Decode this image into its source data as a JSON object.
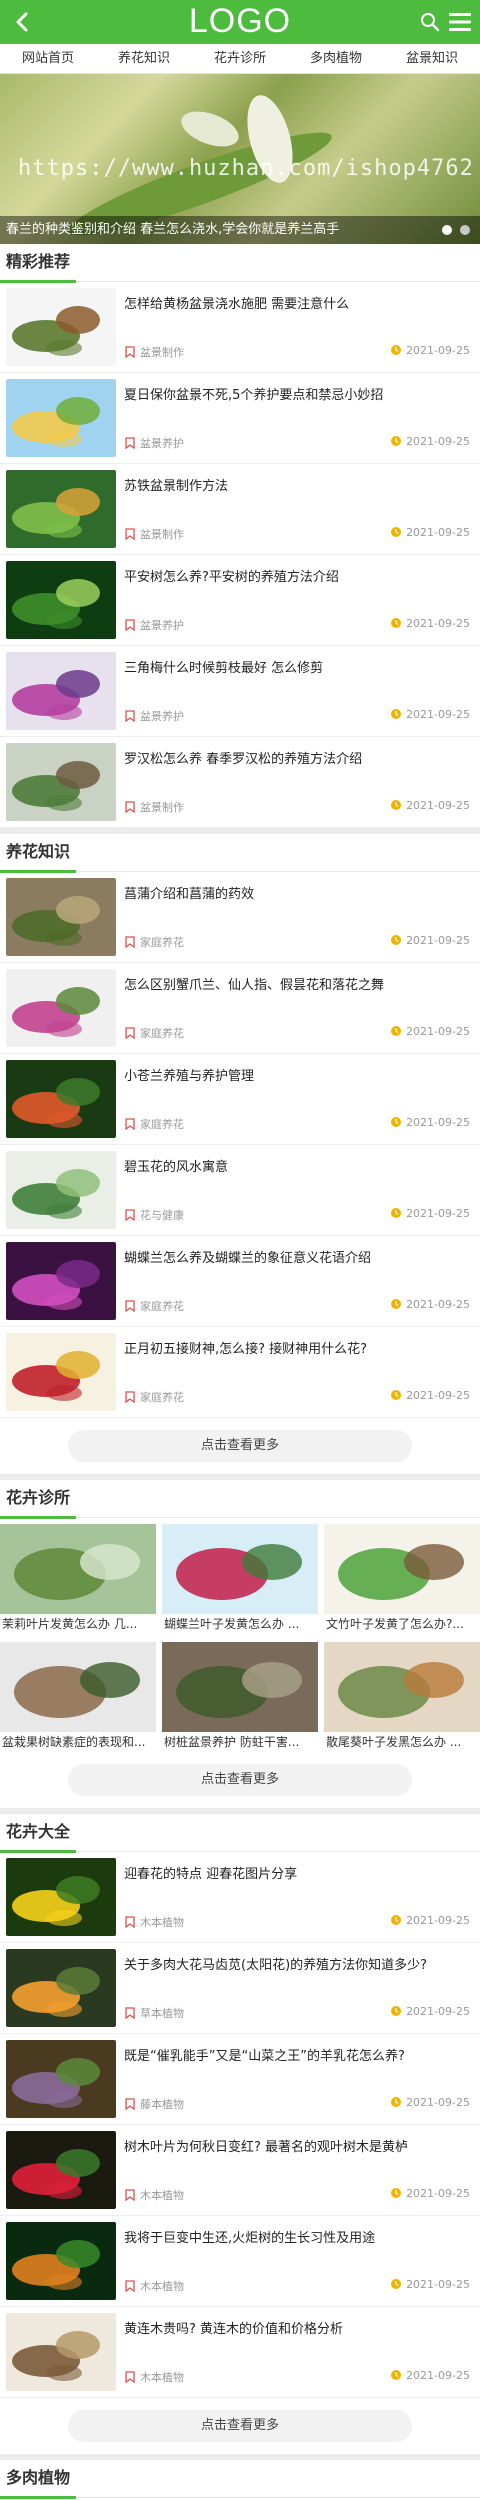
{
  "header": {
    "logo": "LOGO"
  },
  "nav": [
    "网站首页",
    "养花知识",
    "花卉诊所",
    "多肉植物",
    "盆景知识"
  ],
  "banner": {
    "watermark": "https://www.huzhan.com/ishop4762",
    "caption": "春兰的种类鉴别和介绍 春兰怎么浇水,学会你就是养兰高手"
  },
  "featured": {
    "title": "精彩推荐",
    "items": [
      {
        "title": "怎样给黄杨盆景浇水施肥 需要注意什么",
        "cat": "盆景制作",
        "date": "2021-09-25"
      },
      {
        "title": "夏日保你盆景不死,5个养护要点和禁忌小妙招",
        "cat": "盆景养护",
        "date": "2021-09-25"
      },
      {
        "title": "苏铁盆景制作方法",
        "cat": "盆景制作",
        "date": "2021-09-25"
      },
      {
        "title": "平安树怎么养?平安树的养殖方法介绍",
        "cat": "盆景养护",
        "date": "2021-09-25"
      },
      {
        "title": "三角梅什么时候剪枝最好 怎么修剪",
        "cat": "盆景养护",
        "date": "2021-09-25"
      },
      {
        "title": "罗汉松怎么养 春季罗汉松的养殖方法介绍",
        "cat": "盆景制作",
        "date": "2021-09-25"
      }
    ]
  },
  "knowledge": {
    "title": "养花知识",
    "more": "点击查看更多",
    "items": [
      {
        "title": "菖蒲介绍和菖蒲的药效",
        "cat": "家庭养花",
        "date": "2021-09-25"
      },
      {
        "title": "怎么区别蟹爪兰、仙人指、假昙花和落花之舞",
        "cat": "家庭养花",
        "date": "2021-09-25"
      },
      {
        "title": "小苍兰养殖与养护管理",
        "cat": "家庭养花",
        "date": "2021-09-25"
      },
      {
        "title": "碧玉花的风水寓意",
        "cat": "花与健康",
        "date": "2021-09-25"
      },
      {
        "title": "蝴蝶兰怎么养及蝴蝶兰的象征意义花语介绍",
        "cat": "家庭养花",
        "date": "2021-09-25"
      },
      {
        "title": "正月初五接财神,怎么接? 接财神用什么花?",
        "cat": "家庭养花",
        "date": "2021-09-25"
      }
    ]
  },
  "clinic": {
    "title": "花卉诊所",
    "more": "点击查看更多",
    "items": [
      {
        "label": "茉莉叶片发黄怎么办 几..."
      },
      {
        "label": "蝴蝶兰叶子发黄怎么办 ..."
      },
      {
        "label": "文竹叶子发黄了怎么办?..."
      },
      {
        "label": "盆栽果树缺素症的表现和..."
      },
      {
        "label": "树桩盆景养护 防蛀干害..."
      },
      {
        "label": "散尾葵叶子发黑怎么办 ..."
      }
    ]
  },
  "flowers": {
    "title": "花卉大全",
    "more": "点击查看更多",
    "items": [
      {
        "title": "迎春花的特点 迎春花图片分享",
        "cat": "木本植物",
        "date": "2021-09-25"
      },
      {
        "title": "关于多肉大花马齿苋(太阳花)的养殖方法你知道多少?",
        "cat": "草本植物",
        "date": "2021-09-25"
      },
      {
        "title": "既是“催乳能手”又是“山菜之王”的羊乳花怎么养?",
        "cat": "藤本植物",
        "date": "2021-09-25"
      },
      {
        "title": "树木叶片为何秋日变红? 最著名的观叶树木是黄栌",
        "cat": "木本植物",
        "date": "2021-09-25"
      },
      {
        "title": "我将于巨变中生还,火炬树的生长习性及用途",
        "cat": "木本植物",
        "date": "2021-09-25"
      },
      {
        "title": "黄连木贵吗? 黄连木的价值和价格分析",
        "cat": "木本植物",
        "date": "2021-09-25"
      }
    ]
  },
  "succulent": {
    "title": "多肉植物"
  },
  "colors": {
    "primary": "#4cbb3e"
  }
}
